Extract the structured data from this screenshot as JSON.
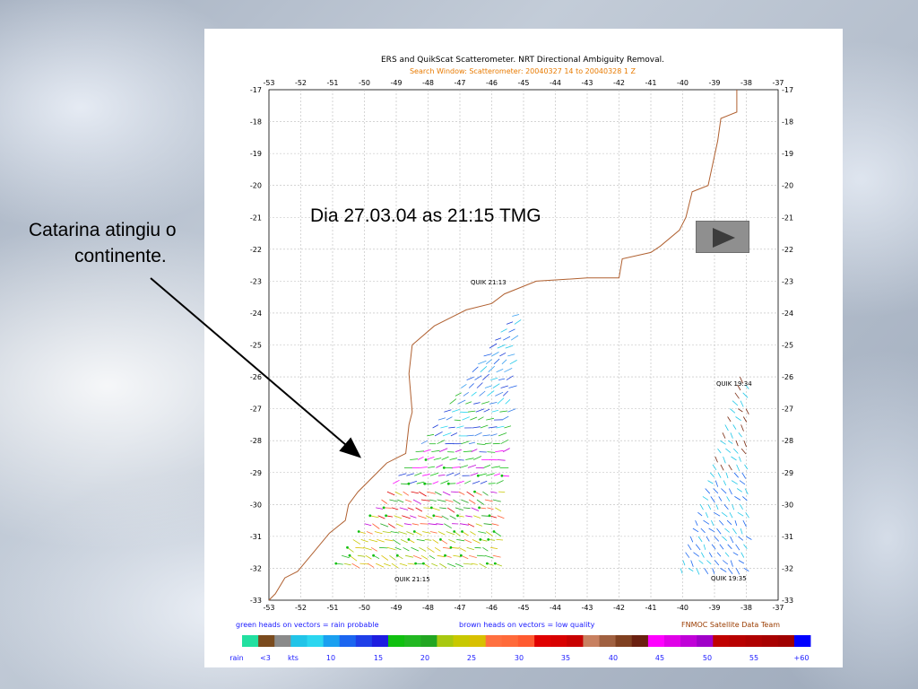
{
  "slide": {
    "caption_line1": "Catarina atingiu o",
    "caption_line2": "continente.",
    "overlay_title": "Dia 27.03.04 as 21:15 TMG",
    "play_button": "play-icon"
  },
  "plot": {
    "title": "ERS and QuikScat Scatterometer. NRT Directional Ambiguity Removal.",
    "subtitle": "Search Window: Scatterometer: 20040327 14 to 20040328 1 Z",
    "title_color": "#000000",
    "subtitle_color": "#e87a00",
    "x_ticks": [
      "-53",
      "-52",
      "-51",
      "-50",
      "-49",
      "-48",
      "-47",
      "-46",
      "-45",
      "-44",
      "-43",
      "-42",
      "-41",
      "-40",
      "-39",
      "-38",
      "-37"
    ],
    "y_ticks": [
      "-17",
      "-18",
      "-19",
      "-20",
      "-21",
      "-22",
      "-23",
      "-24",
      "-25",
      "-26",
      "-27",
      "-28",
      "-29",
      "-30",
      "-31",
      "-32",
      "-33"
    ],
    "pass_labels": [
      {
        "text": "QUIK 21:13"
      },
      {
        "text": "QUIK 21:15"
      },
      {
        "text": "QUIK 19:34"
      },
      {
        "text": "QUIK 19:35"
      }
    ],
    "legend_notes": {
      "green": "green heads on vectors = rain probable",
      "brown": "brown heads on vectors = low quality",
      "credit": "FNMOC Satellite Data Team"
    },
    "colorbar_labels": [
      "rain",
      "<3",
      "kts",
      "10",
      "15",
      "20",
      "25",
      "30",
      "35",
      "40",
      "45",
      "50",
      "55",
      "+60"
    ],
    "colorbar_colors": [
      "#22e0a0",
      "#7a4b1e",
      "#8a8a8a",
      "#21c4e8",
      "#2bd6f0",
      "#1aa0f0",
      "#1b66f0",
      "#1f3fe8",
      "#1e1ee0",
      "#10c010",
      "#22b822",
      "#22a622",
      "#a8c810",
      "#c8c800",
      "#d8c000",
      "#ff7040",
      "#ff6a3a",
      "#ff5a30",
      "#e00000",
      "#d80000",
      "#c80000",
      "#c88060",
      "#a06040",
      "#804020",
      "#6a2010",
      "#ff00ff",
      "#e000e8",
      "#c000d8",
      "#a000c8",
      "#c00000",
      "#b80000",
      "#b00000",
      "#a80000",
      "#a00000",
      "#0000ff"
    ],
    "coast_color": "#b06030",
    "tick_label_color": "#000000",
    "legend_color": "#1a1aff",
    "credit_color": "#9a3c00"
  }
}
